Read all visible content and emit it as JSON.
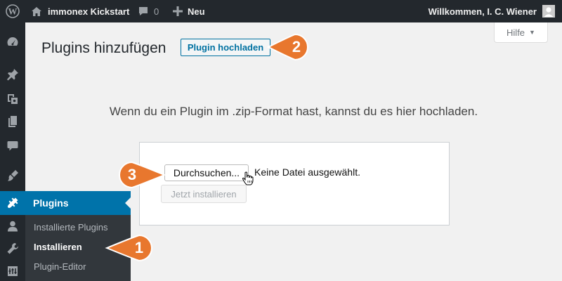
{
  "admin_bar": {
    "site_name": "immonex Kickstart",
    "comments_count": "0",
    "new_label": "Neu",
    "greeting": "Willkommen, I. C. Wiener"
  },
  "help_tab": {
    "label": "Hilfe"
  },
  "heading": {
    "title": "Plugins hinzufügen",
    "upload_button": "Plugin hochladen"
  },
  "upload": {
    "help_text": "Wenn du ein Plugin im .zip-Format hast, kannst du es hier hochladen.",
    "browse_button": "Durchsuchen...",
    "file_status": "Keine Datei ausgewählt.",
    "install_button": "Jetzt installieren"
  },
  "menu": {
    "plugins_label": "Plugins",
    "submenu": [
      {
        "label": "Installierte Plugins",
        "current": false
      },
      {
        "label": "Installieren",
        "current": true
      },
      {
        "label": "Plugin-Editor",
        "current": false
      }
    ]
  },
  "callouts": [
    "1",
    "2",
    "3"
  ],
  "colors": {
    "admin_bar": "#23282d",
    "menu_active": "#0073aa",
    "submenu_bg": "#32373c",
    "callout": "#e8772e",
    "button_border": "#0071a1"
  }
}
